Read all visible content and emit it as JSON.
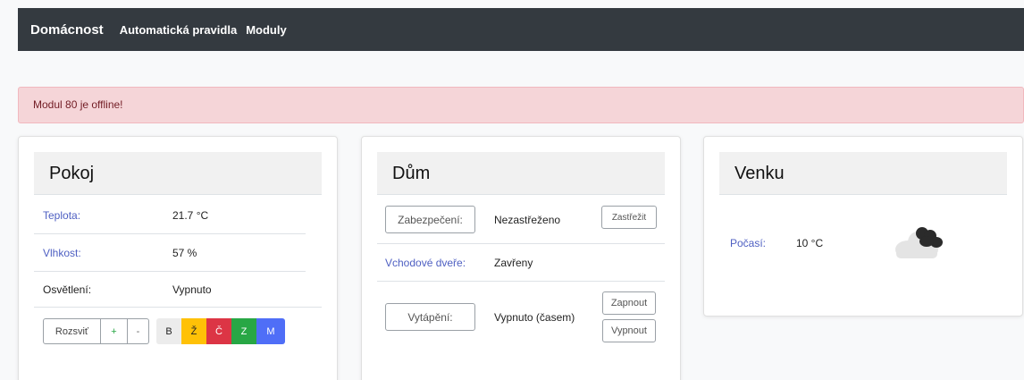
{
  "navbar": {
    "brand": "Domácnost",
    "links": [
      "Automatická pravidla",
      "Moduly"
    ]
  },
  "alert": {
    "text": "Modul 80 je offline!"
  },
  "pokoj": {
    "title": "Pokoj",
    "teplota_label": "Teplota:",
    "teplota_value": "21.7 °C",
    "vlhkost_label": "Vlhkost:",
    "vlhkost_value": "57 %",
    "osvetleni_label": "Osvětlení:",
    "osvetleni_value": "Vypnuto",
    "buttons": {
      "rozsvit": "Rozsviť",
      "plus": "+",
      "minus": "-",
      "colors": [
        "B",
        "Ž",
        "Č",
        "Z",
        "M"
      ]
    }
  },
  "dum": {
    "title": "Dům",
    "zabezpeceni_label": "Zabezpečení:",
    "zabezpeceni_value": "Nezastřeženo",
    "zastrezit": "Zastřežit",
    "dvere_label": "Vchodové dveře:",
    "dvere_value": "Zavřeny",
    "vytapeni_label": "Vytápění:",
    "vytapeni_value": "Vypnuto (časem)",
    "zapnout": "Zapnout",
    "vypnout": "Vypnout"
  },
  "venku": {
    "title": "Venku",
    "pocasi_label": "Počasí:",
    "pocasi_value": "10 °C",
    "weather_icon": "cloudy-icon"
  },
  "colors": {
    "navbar": "#343a40",
    "alert_bg": "#f5d5d8",
    "link_label": "#4e5fc2",
    "btn_white": "#f8f9fa",
    "btn_yellow": "#ffc107",
    "btn_red": "#dc3545",
    "btn_green": "#28a745",
    "btn_blue": "#4f6ef7"
  }
}
